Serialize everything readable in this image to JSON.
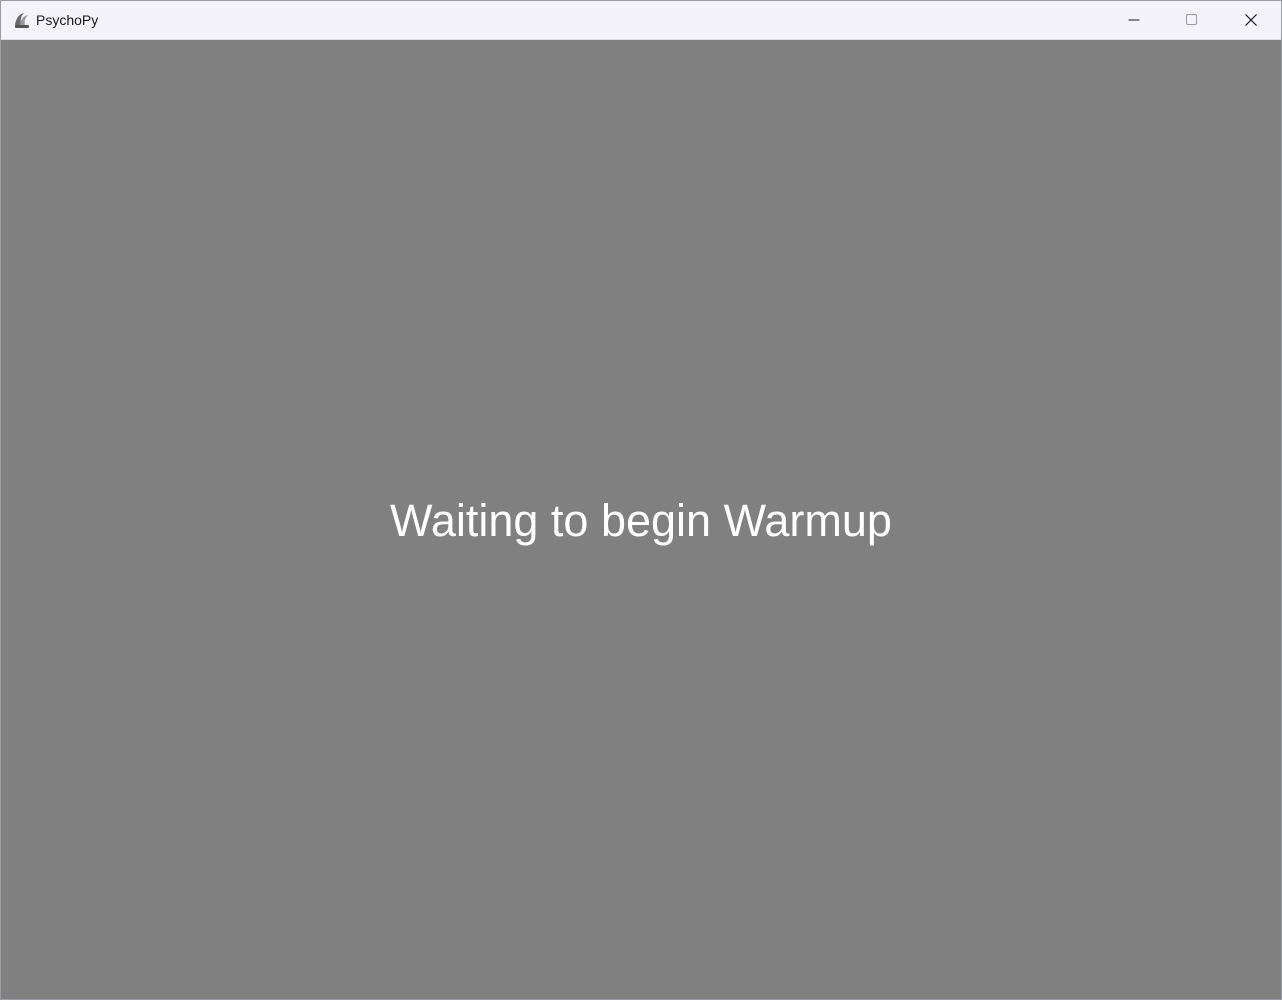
{
  "window": {
    "title": "PsychoPy",
    "icon": "psychopy-logo-icon",
    "controls": {
      "minimize": "minimize-icon",
      "maximize": "maximize-icon",
      "close": "close-icon"
    }
  },
  "stimulus": {
    "text": "Waiting to begin Warmup"
  },
  "colors": {
    "background": "#808080",
    "text": "#ffffff",
    "titlebar": "#f3f3f9"
  }
}
